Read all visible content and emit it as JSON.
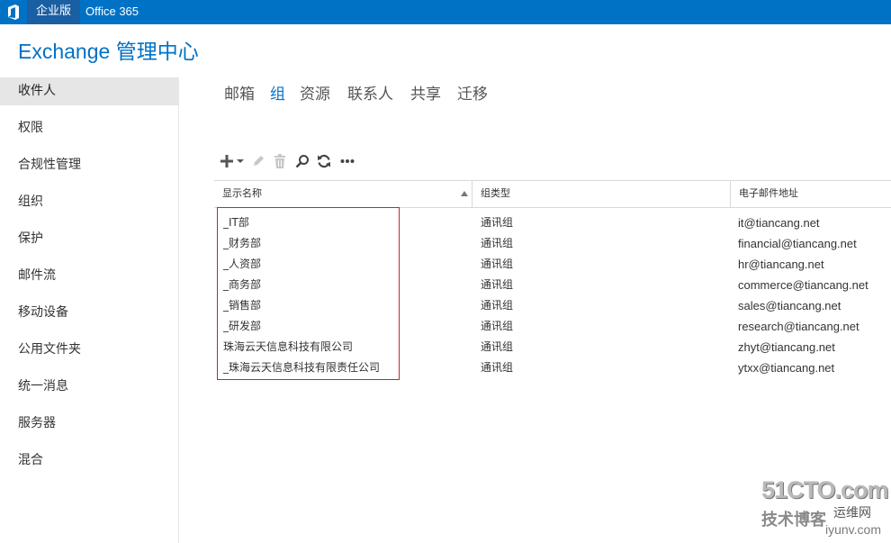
{
  "topbar": {
    "logo_icon": "office-logo-icon",
    "tab_enterprise": "企业版",
    "tab_office365": "Office 365",
    "bar_color": "#0072c6"
  },
  "app_title": "Exchange 管理中心",
  "sidebar": {
    "items": [
      {
        "label": "收件人",
        "active": true
      },
      {
        "label": "权限"
      },
      {
        "label": "合规性管理"
      },
      {
        "label": "组织"
      },
      {
        "label": "保护"
      },
      {
        "label": "邮件流"
      },
      {
        "label": "移动设备"
      },
      {
        "label": "公用文件夹"
      },
      {
        "label": "统一消息"
      },
      {
        "label": "服务器"
      },
      {
        "label": "混合"
      }
    ]
  },
  "subnav": {
    "tabs": [
      {
        "label": "邮箱"
      },
      {
        "label": "组",
        "active": true
      },
      {
        "label": "资源"
      },
      {
        "label": "联系人"
      },
      {
        "label": "共享"
      },
      {
        "label": "迁移"
      }
    ]
  },
  "toolbar": {
    "icons": [
      "add-icon",
      "dropdown-arrow-icon",
      "edit-icon",
      "delete-icon",
      "search-icon",
      "refresh-icon",
      "more-icon"
    ]
  },
  "table": {
    "columns": [
      "显示名称",
      "组类型",
      "电子邮件地址"
    ],
    "sorted_column": "显示名称",
    "rows": [
      {
        "name": "_IT部",
        "type": "通讯组",
        "email": "it@tiancang.net"
      },
      {
        "name": "_财务部",
        "type": "通讯组",
        "email": "financial@tiancang.net"
      },
      {
        "name": "_人资部",
        "type": "通讯组",
        "email": "hr@tiancang.net"
      },
      {
        "name": "_商务部",
        "type": "通讯组",
        "email": "commerce@tiancang.net"
      },
      {
        "name": "_销售部",
        "type": "通讯组",
        "email": "sales@tiancang.net"
      },
      {
        "name": "_研发部",
        "type": "通讯组",
        "email": "research@tiancang.net"
      },
      {
        "name": "珠海云天信息科技有限公司",
        "type": "通讯组",
        "email": "zhyt@tiancang.net"
      },
      {
        "name": "_珠海云天信息科技有限责任公司",
        "type": "通讯组",
        "email": "ytxx@tiancang.net"
      }
    ]
  },
  "watermark": {
    "line1": "51CTO.com",
    "line2": "技术博客",
    "line3": "运维网",
    "line4": "iyunv.com"
  },
  "colors": {
    "accent": "#0072c6",
    "highlight_border": "#c0272d"
  }
}
